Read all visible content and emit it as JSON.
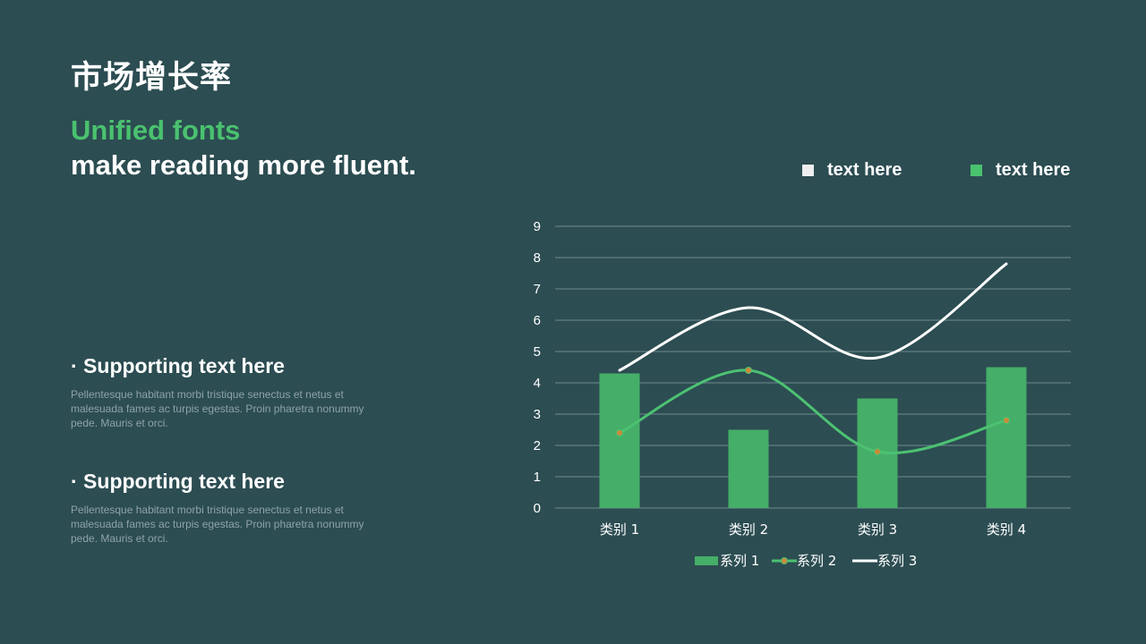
{
  "slide": {
    "title": "市场增长率",
    "subtitle_green": "Unified fonts",
    "subtitle_white": "make reading more fluent.",
    "support_items": [
      {
        "heading": "· Supporting text here",
        "body": "Pellentesque  habitant morbi tristique senectus et netus et malesuada fames ac turpis egestas. Proin pharetra nonummy pede. Mauris et orci."
      },
      {
        "heading": "· Supporting text here",
        "body": "Pellentesque  habitant morbi tristique senectus et netus et malesuada fames ac turpis egestas. Proin pharetra nonummy pede. Mauris et orci."
      }
    ],
    "top_legend": [
      {
        "label": "text here",
        "color": "#eeeeee"
      },
      {
        "label": "text here",
        "color": "#4ac16e"
      }
    ]
  },
  "colors": {
    "background": "#2c4d52",
    "accent_green": "#4ac16e",
    "bar_green": "#45ae68",
    "line_green": "#4cc272",
    "line_white": "#ffffff",
    "marker_orange": "#c98a3a",
    "gridline": "#6f8a8e"
  },
  "chart_data": {
    "type": "bar",
    "categories": [
      "类别 1",
      "类别 2",
      "类别 3",
      "类别 4"
    ],
    "series": [
      {
        "name": "系列 1",
        "type": "bar",
        "values": [
          4.3,
          2.5,
          3.5,
          4.5
        ]
      },
      {
        "name": "系列 2",
        "type": "line",
        "smooth": true,
        "markers": true,
        "values": [
          2.4,
          4.4,
          1.8,
          2.8
        ]
      },
      {
        "name": "系列 3",
        "type": "line",
        "smooth": true,
        "markers": false,
        "values": [
          4.4,
          6.4,
          4.8,
          7.8
        ]
      }
    ],
    "ylim": [
      0,
      9
    ],
    "yticks": [
      0,
      1,
      2,
      3,
      4,
      5,
      6,
      7,
      8,
      9
    ],
    "grid": true,
    "legend_position": "bottom"
  }
}
